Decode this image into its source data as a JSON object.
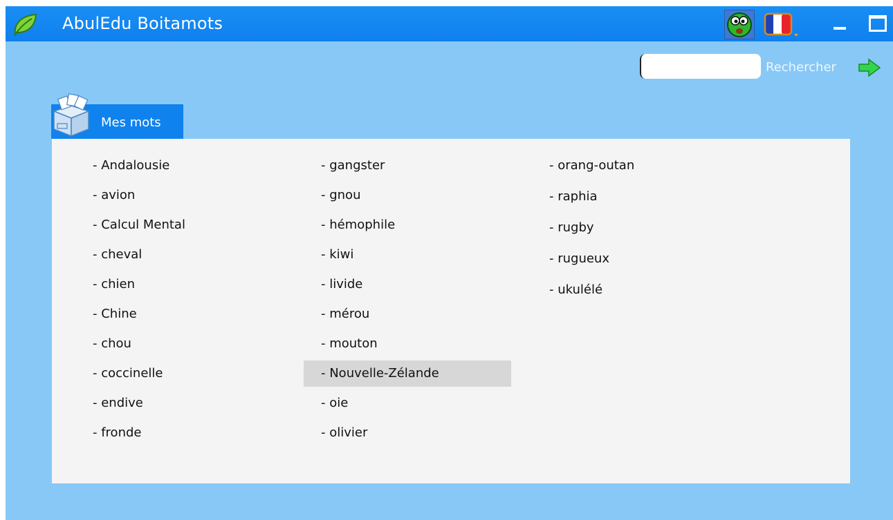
{
  "window": {
    "title": "AbulEdu Boitamots",
    "icons": [
      "leaf-icon",
      "mascot-icon",
      "french-flag-icon",
      "minimize-icon",
      "maximize-icon"
    ],
    "accent_color": "#0f80ee",
    "background_color": "#87c8f7"
  },
  "search": {
    "value": "",
    "placeholder": "",
    "button_label": "Rechercher"
  },
  "tab": {
    "label": "Mes mots"
  },
  "words": {
    "col1": [
      "- Andalousie",
      "- avion",
      "- Calcul Mental",
      "- cheval",
      "- chien",
      "- Chine",
      "- chou",
      "- coccinelle",
      "- endive",
      "- fronde"
    ],
    "col2": [
      "- gangster",
      "- gnou",
      "- hémophile",
      "- kiwi",
      "- livide",
      "- mérou",
      "- mouton",
      "- Nouvelle-Zélande",
      "- oie",
      "- olivier"
    ],
    "col3": [
      "- orang-outan",
      "- raphia",
      "- rugby",
      "- rugueux",
      "- ukulélé"
    ],
    "selected": "- Nouvelle-Zélande"
  }
}
